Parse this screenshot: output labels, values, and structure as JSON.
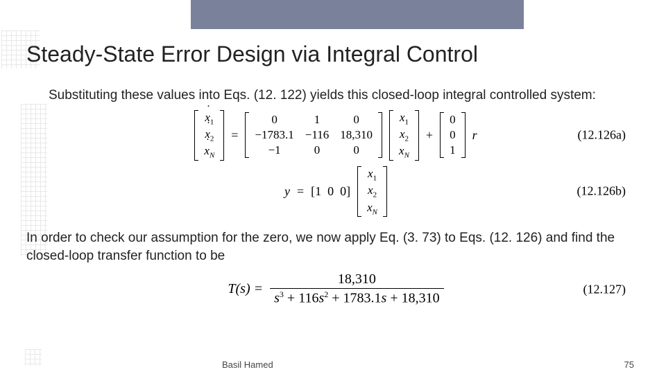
{
  "title": "Steady-State Error Design via Integral Control",
  "para1": "Substituting these values into Eqs. (12. 122) yields this closed-loop integral controlled system:",
  "para2": "In order to check our assumption for the zero, we now apply Eq. (3. 73) to Eqs. (12. 126) and find the closed-loop transfer function to be",
  "eq_a": {
    "lhs": {
      "rows": [
        [
          "ẋ₁"
        ],
        [
          "ẋ₂"
        ],
        [
          "ẋN"
        ]
      ]
    },
    "A": {
      "rows": [
        [
          "0",
          "1",
          "0"
        ],
        [
          "−1783.1",
          "−116",
          "18,310"
        ],
        [
          "−1",
          "0",
          "0"
        ]
      ]
    },
    "x": {
      "rows": [
        [
          "x₁"
        ],
        [
          "x₂"
        ],
        [
          "xN"
        ]
      ]
    },
    "B": {
      "rows": [
        [
          "0"
        ],
        [
          "0"
        ],
        [
          "1"
        ]
      ]
    },
    "input": "r",
    "label": "(12.126a)"
  },
  "eq_b": {
    "y": "y",
    "C": {
      "rows": [
        [
          "1",
          "0",
          "0"
        ]
      ]
    },
    "x": {
      "rows": [
        [
          "x₁"
        ],
        [
          "x₂"
        ],
        [
          "xN"
        ]
      ]
    },
    "label": "(12.126b)"
  },
  "eq_tf": {
    "lhs": "T(s)",
    "num": "18,310",
    "den": "s³ + 116s² + 1783.1s + 18,310",
    "label": "(12.127)"
  },
  "footer": {
    "author": "Basil Hamed",
    "page": "75"
  }
}
